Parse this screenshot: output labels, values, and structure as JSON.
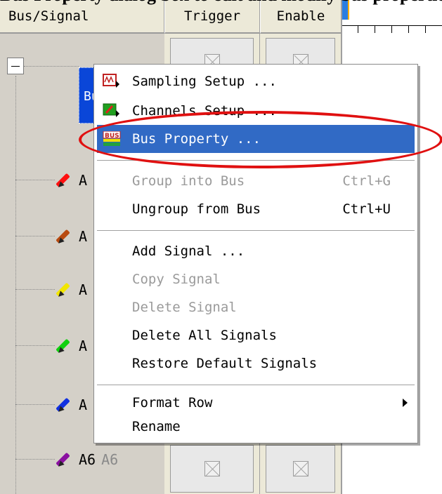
{
  "caption": "Bus Property dialog box to edit and modify bus properties",
  "header": {
    "bus_signal": "Bus/Signal",
    "trigger": "Trigger",
    "enable": "Enable"
  },
  "tree": {
    "bus_label": "Bus1",
    "signals": [
      {
        "label": "A",
        "sub": "",
        "color": "#ff1010"
      },
      {
        "label": "A",
        "sub": "",
        "color": "#b84a10"
      },
      {
        "label": "A",
        "sub": "",
        "color": "#f2e600"
      },
      {
        "label": "A",
        "sub": "",
        "color": "#10d010"
      },
      {
        "label": "A",
        "sub": "",
        "color": "#1030e0"
      },
      {
        "label": "A6",
        "sub": "A6",
        "color": "#8a10a0"
      }
    ]
  },
  "context_menu": {
    "items": [
      {
        "label": "Sampling Setup ...",
        "shortcut": "",
        "state": "enabled",
        "icon": "sampling-setup-icon"
      },
      {
        "label": "Channels Setup ...",
        "shortcut": "",
        "state": "enabled",
        "icon": "channels-setup-icon"
      },
      {
        "label": "Bus Property ...",
        "shortcut": "",
        "state": "selected",
        "icon": "bus-property-icon"
      },
      {
        "label": "Group into Bus",
        "shortcut": "Ctrl+G",
        "state": "disabled"
      },
      {
        "label": "Ungroup from Bus",
        "shortcut": "Ctrl+U",
        "state": "enabled"
      },
      {
        "label": "Add Signal ...",
        "shortcut": "",
        "state": "enabled"
      },
      {
        "label": "Copy Signal",
        "shortcut": "",
        "state": "disabled"
      },
      {
        "label": "Delete Signal",
        "shortcut": "",
        "state": "disabled"
      },
      {
        "label": "Delete All Signals",
        "shortcut": "",
        "state": "enabled"
      },
      {
        "label": "Restore Default Signals",
        "shortcut": "",
        "state": "enabled"
      },
      {
        "label": "Format Row",
        "shortcut": "",
        "state": "enabled",
        "submenu": true
      },
      {
        "label": "Rename",
        "shortcut": "",
        "state": "enabled"
      }
    ]
  },
  "colors": {
    "selection": "#316ac5",
    "highlight_ring": "#e01010"
  }
}
